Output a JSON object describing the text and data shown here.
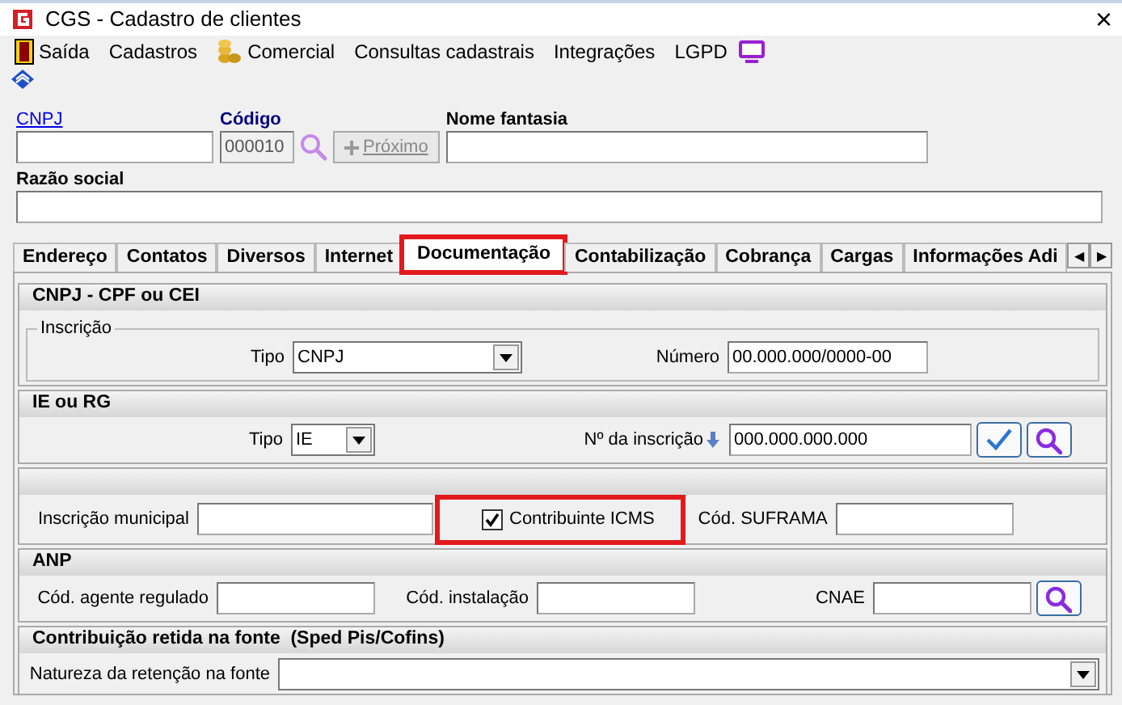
{
  "window": {
    "title": "CGS - Cadastro de clientes",
    "close": "×"
  },
  "menu": [
    {
      "label": "Saída"
    },
    {
      "label": "Cadastros"
    },
    {
      "label": "Comercial"
    },
    {
      "label": "Consultas cadastrais"
    },
    {
      "label": "Integrações"
    },
    {
      "label": "LGPD"
    }
  ],
  "header": {
    "cnpj": {
      "label": "CNPJ"
    },
    "codigo": {
      "label": "Código",
      "value": "000010"
    },
    "next_button": {
      "label": "Próximo",
      "disabled": true
    },
    "nome_fantasia": {
      "label": "Nome fantasia"
    },
    "razao_social": {
      "label": "Razão social"
    }
  },
  "tabs": [
    {
      "label": "Endereço",
      "selected": false,
      "highlighted": false
    },
    {
      "label": "Contatos",
      "selected": false,
      "highlighted": false
    },
    {
      "label": "Diversos",
      "selected": false,
      "highlighted": false
    },
    {
      "label": "Internet",
      "selected": false,
      "highlighted": false
    },
    {
      "label": "Documentação",
      "selected": true,
      "highlighted": true
    },
    {
      "label": "Contabilização",
      "selected": false,
      "highlighted": false
    },
    {
      "label": "Cobrança",
      "selected": false,
      "highlighted": false
    },
    {
      "label": "Cargas",
      "selected": false,
      "highlighted": false
    },
    {
      "label": "Informações Adi",
      "selected": false,
      "highlighted": false
    }
  ],
  "tab_scroll": [
    "◀",
    "▶"
  ],
  "cnpj_section": {
    "title": "CNPJ - CPF ou CEI",
    "group": "Inscrição",
    "tipo": {
      "label": "Tipo",
      "value": "CNPJ"
    },
    "numero": {
      "label": "Número",
      "value": "00.000.000/0000-00"
    }
  },
  "ie_section": {
    "title": "IE ou RG",
    "tipo": {
      "label": "Tipo",
      "value": "IE"
    },
    "inscricao": {
      "label": "Nº da inscrição",
      "value": "000.000.000.000"
    }
  },
  "other_section": {
    "municipal": {
      "label": "Inscrição municipal"
    },
    "icms": {
      "label": "Contribuinte ICMS",
      "checked": true,
      "highlighted": true
    },
    "suframa": {
      "label": "Cód. SUFRAMA"
    }
  },
  "anp_section": {
    "title": "ANP",
    "agente": {
      "label": "Cód. agente regulado"
    },
    "instalacao": {
      "label": "Cód. instalação"
    },
    "cnae": {
      "label": "CNAE"
    }
  },
  "retencao_section": {
    "title": "Contribuição retida na fonte  (Sped Pis/Cofins)",
    "natureza": {
      "label": "Natureza da retenção na fonte"
    }
  }
}
